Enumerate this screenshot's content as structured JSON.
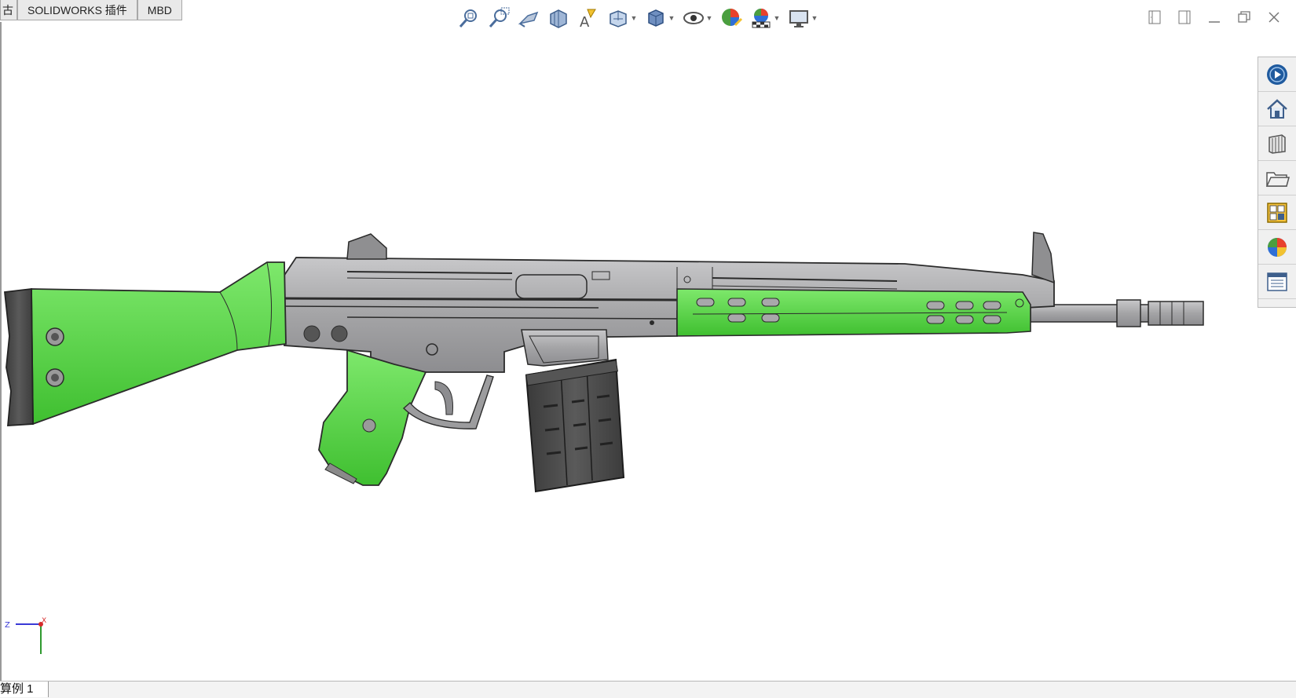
{
  "tabs": [
    {
      "label": "古"
    },
    {
      "label": "SOLIDWORKS 插件"
    },
    {
      "label": "MBD"
    }
  ],
  "hud_icons": [
    "zoom-to-fit-icon",
    "zoom-to-area-icon",
    "previous-view-icon",
    "section-view-icon",
    "dynamic-annotation-icon",
    "view-orientation-icon",
    "display-style-icon",
    "hide-show-items-icon",
    "edit-appearance-icon",
    "apply-scene-icon",
    "view-settings-icon"
  ],
  "task_pane_icons": [
    "solidworks-resources-icon",
    "design-library-icon",
    "file-explorer-icon",
    "open-folder-icon",
    "view-palette-icon",
    "appearances-icon",
    "custom-properties-icon"
  ],
  "colors": {
    "part_green": "#5fd34e",
    "metal_gray": "#a7a7a9",
    "dark_gray": "#4a4a4a",
    "outline": "#2b2b2b"
  },
  "triad": {
    "z_label": "Z",
    "x_label": "X"
  },
  "bottom_tabs": [
    {
      "label": "算例 1"
    }
  ]
}
